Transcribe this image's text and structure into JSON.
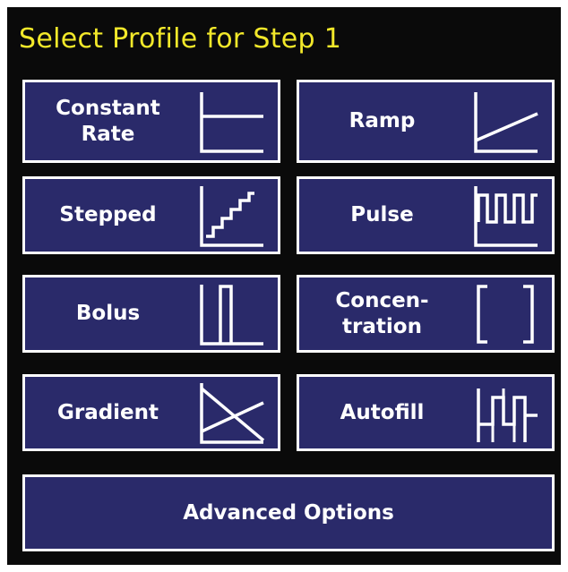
{
  "screen": {
    "title": "Select Profile for Step 1"
  },
  "profiles": [
    {
      "line1": "Constant",
      "line2": "Rate",
      "icon": "constant-rate-icon"
    },
    {
      "line1": "Ramp",
      "line2": "",
      "icon": "ramp-icon"
    },
    {
      "line1": "Stepped",
      "line2": "",
      "icon": "stepped-icon"
    },
    {
      "line1": "Pulse",
      "line2": "",
      "icon": "pulse-icon"
    },
    {
      "line1": "Bolus",
      "line2": "",
      "icon": "bolus-icon"
    },
    {
      "line1": "Concen-",
      "line2": "tration",
      "icon": "concentration-icon"
    },
    {
      "line1": "Gradient",
      "line2": "",
      "icon": "gradient-icon"
    },
    {
      "line1": "Autofill",
      "line2": "",
      "icon": "autofill-icon"
    }
  ],
  "advanced": {
    "label": "Advanced Options"
  },
  "colors": {
    "background": "#0a0a0a",
    "button": "#2a2a6a",
    "title_text": "#f2e82a",
    "button_text": "#ffffff"
  }
}
